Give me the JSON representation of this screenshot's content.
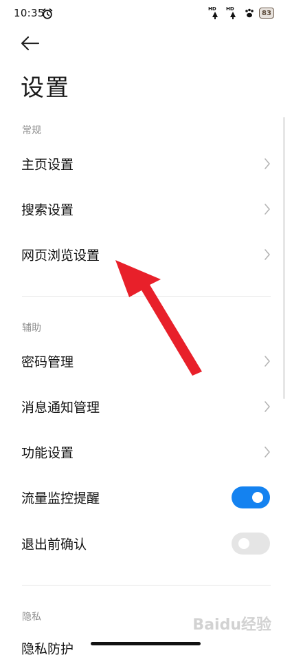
{
  "status_bar": {
    "time": "10:35",
    "battery": "83",
    "network_label": "HD"
  },
  "page": {
    "title": "设置"
  },
  "sections": {
    "general": {
      "label": "常规",
      "items": [
        "主页设置",
        "搜索设置",
        "网页浏览设置"
      ]
    },
    "assist": {
      "label": "辅助",
      "items": [
        "密码管理",
        "消息通知管理",
        "功能设置"
      ],
      "toggles": [
        {
          "label": "流量监控提醒",
          "on": true
        },
        {
          "label": "退出前确认",
          "on": false
        }
      ]
    },
    "privacy": {
      "label": "隐私",
      "items": [
        "隐私防护"
      ]
    }
  },
  "watermark": "Baidu经验",
  "colors": {
    "accent": "#1482f0",
    "annotation_arrow": "#e8202a",
    "toggle_off": "#e5e5e5"
  },
  "icons": {
    "back": "arrow-left-icon",
    "chevron": "chevron-right-icon",
    "alarm": "alarm-clock-icon",
    "paw": "paw-icon"
  }
}
